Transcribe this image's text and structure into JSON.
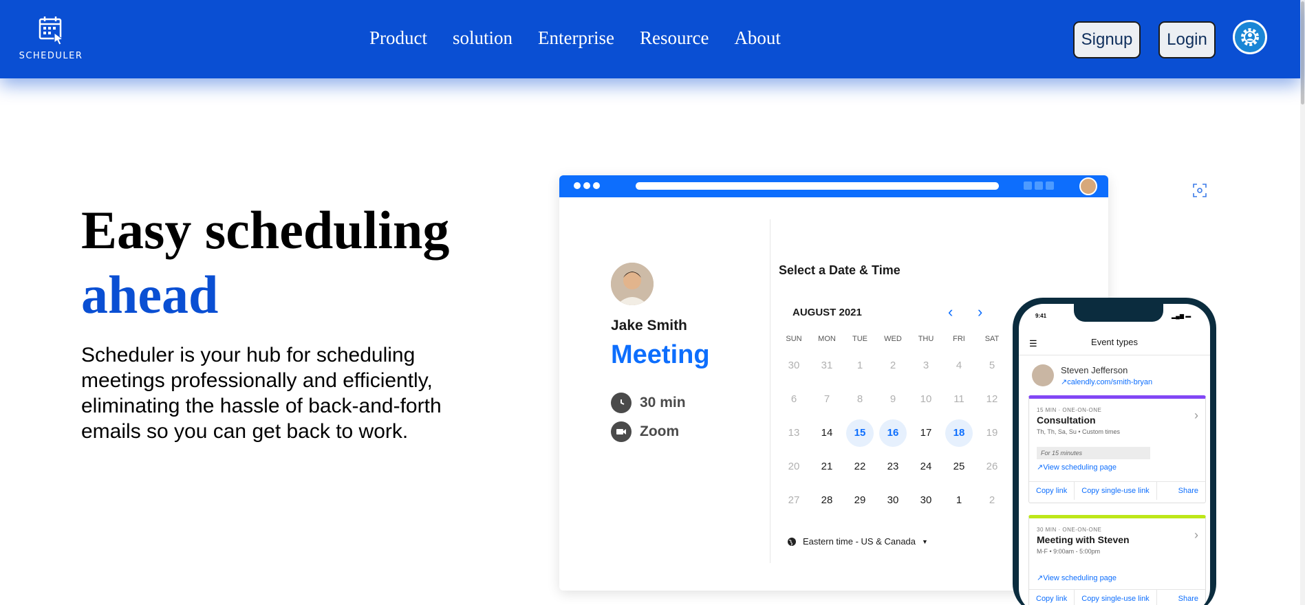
{
  "header": {
    "logo_text": "SCHEDULER",
    "nav": [
      "Product",
      "solution",
      "Enterprise",
      "Resource",
      "About"
    ],
    "signup": "Signup",
    "login": "Login",
    "brand_color": "#0a4fd3"
  },
  "hero": {
    "title_line1": "Easy scheduling",
    "title_line2": "ahead",
    "description": "Scheduler is your hub for scheduling meetings professionally and efficiently, eliminating the hassle of back-and-forth emails so you can get back to work."
  },
  "booking": {
    "host": "Jake Smith",
    "event": "Meeting",
    "duration": "30 min",
    "location": "Zoom",
    "select_title": "Select a Date & Time",
    "month": "AUGUST 2021",
    "weekdays": [
      "SUN",
      "MON",
      "TUE",
      "WED",
      "THU",
      "FRI",
      "SAT"
    ],
    "weeks": [
      [
        "30",
        "31",
        "1",
        "2",
        "3",
        "4",
        "5"
      ],
      [
        "6",
        "7",
        "8",
        "9",
        "10",
        "11",
        "12"
      ],
      [
        "13",
        "14",
        "15",
        "16",
        "17",
        "18",
        "19"
      ],
      [
        "20",
        "21",
        "22",
        "23",
        "24",
        "25",
        "26"
      ],
      [
        "27",
        "28",
        "29",
        "30",
        "30",
        "1",
        "2"
      ]
    ],
    "timezone": "Eastern time - US & Canada"
  },
  "phone": {
    "time": "9:41",
    "title": "Event types",
    "user": "Steven Jefferson",
    "user_link": "calendly.com/smith-bryan",
    "cards": [
      {
        "meta": "15 MIN · ONE-ON-ONE",
        "title": "Consultation",
        "sub": "Th, Th, Sa, Su • Custom times",
        "pill": "For 15 minutes",
        "link": "View scheduling page",
        "actions": [
          "Copy link",
          "Copy single-use link",
          "Share"
        ]
      },
      {
        "meta": "30 MIN · ONE-ON-ONE",
        "title": "Meeting with Steven",
        "sub": "M-F • 9:00am - 5:00pm",
        "link": "View scheduling page",
        "actions": [
          "Copy link",
          "Copy single-use link",
          "Share"
        ]
      }
    ]
  }
}
